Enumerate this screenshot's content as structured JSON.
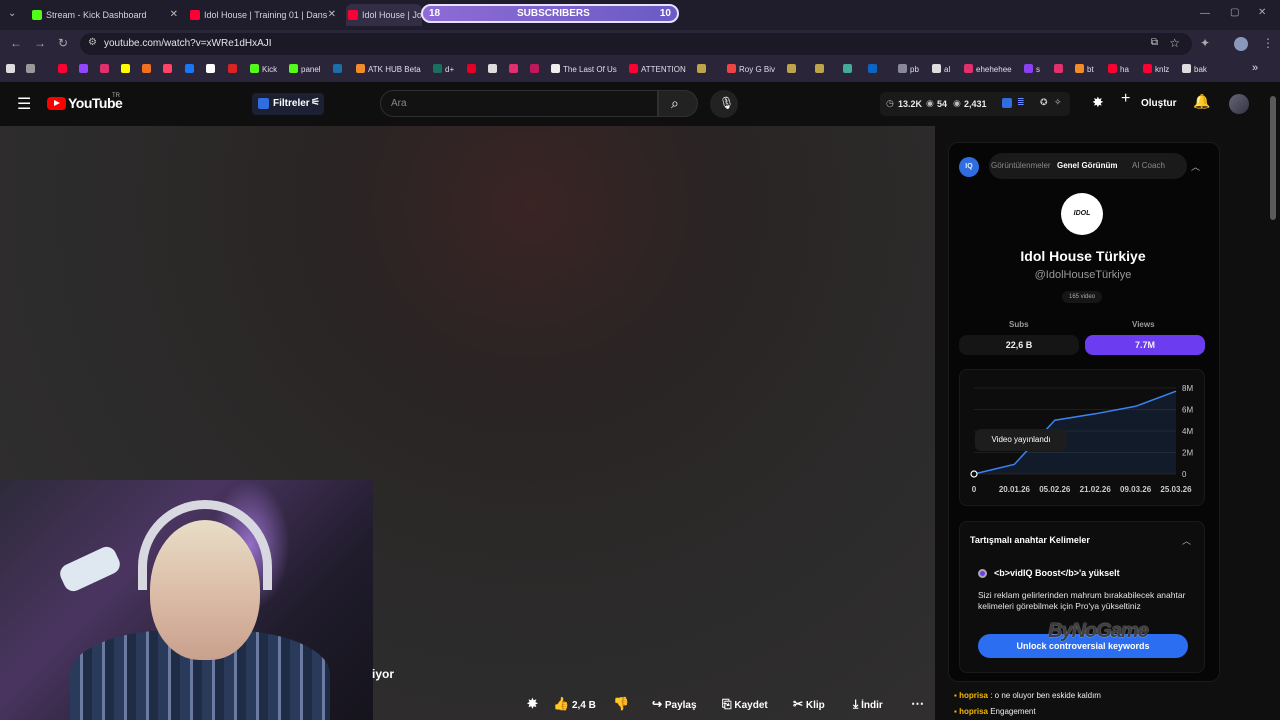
{
  "browser": {
    "tabs": [
      {
        "title": "Stream - Kick Dashboard",
        "icon": "kick-icon"
      },
      {
        "title": "Idol House | Training 01 | Dans",
        "icon": "youtube-icon"
      },
      {
        "title": "Idol House | Jou",
        "icon": "youtube-icon"
      }
    ],
    "subs_overlay": {
      "left_count": "18",
      "label": "SUBSCRIBERS",
      "right_count": "10"
    },
    "url": "youtube.com/watch?v=xWRe1dHxAJI",
    "bookmarks": [
      "Kick",
      "panel",
      "ATK HUB Beta",
      "d+",
      "The Last Of Us",
      "ATTENTION",
      "Roy G Biv",
      "pb",
      "al",
      "ehehehee",
      "s",
      "bt",
      "ha",
      "knlz",
      "bak"
    ]
  },
  "youtube": {
    "logo_text": "YouTube",
    "country": "TR",
    "filters_label": "Filtreler",
    "search_placeholder": "Ara",
    "stats": {
      "views": "13.2K",
      "watching": "54",
      "subs": "2,431"
    },
    "create_label": "Oluştur"
  },
  "video": {
    "caption_fragment": "iyor",
    "actions": {
      "likes": "2,4 B",
      "share": "Paylaş",
      "save": "Kaydet",
      "clip": "Klip",
      "download": "İndir"
    }
  },
  "vidiq": {
    "tabs": [
      "Görüntülenmeler",
      "Genel Görünüm",
      "AI Coach"
    ],
    "active_tab": "Genel Görünüm",
    "avatar_text": "IDOL HOUSE",
    "channel_name": "Idol House Türkiye",
    "handle": "@IdolHouseTürkiye",
    "video_count": "165 video",
    "subs_label": "Subs",
    "subs_value": "22,6 B",
    "views_label": "Views",
    "views_value": "7.7M",
    "tooltip": "Video yayınlandı",
    "keywords_title": "Tartışmalı anahtar Kelimeler",
    "boost_text": "<b>vidIQ Boost</b>'a yükselt",
    "boost_desc": "Sizi reklam gelirlerinden mahrum bırakabilecek anahtar kelimeleri görebilmek için Pro'ya yükseltiniz",
    "unlock_label": "Unlock controversial keywords"
  },
  "chart_data": {
    "type": "line",
    "x": [
      "0",
      "20.01.26",
      "05.02.26",
      "21.02.26",
      "09.03.26",
      "25.03.26"
    ],
    "y_ticks": [
      "0",
      "2M",
      "4M",
      "6M",
      "8M"
    ],
    "series": [
      {
        "values": [
          0,
          0.9,
          5.0,
          5.6,
          6.3,
          7.7
        ]
      }
    ],
    "ylim": [
      0,
      8
    ]
  },
  "watermark": "ByNoGame",
  "chat": [
    {
      "user": "hoprisa",
      "text": ": o ne oluyor ben eskide kaldım"
    },
    {
      "user": "hoprisa",
      "text": "Engagement"
    }
  ]
}
